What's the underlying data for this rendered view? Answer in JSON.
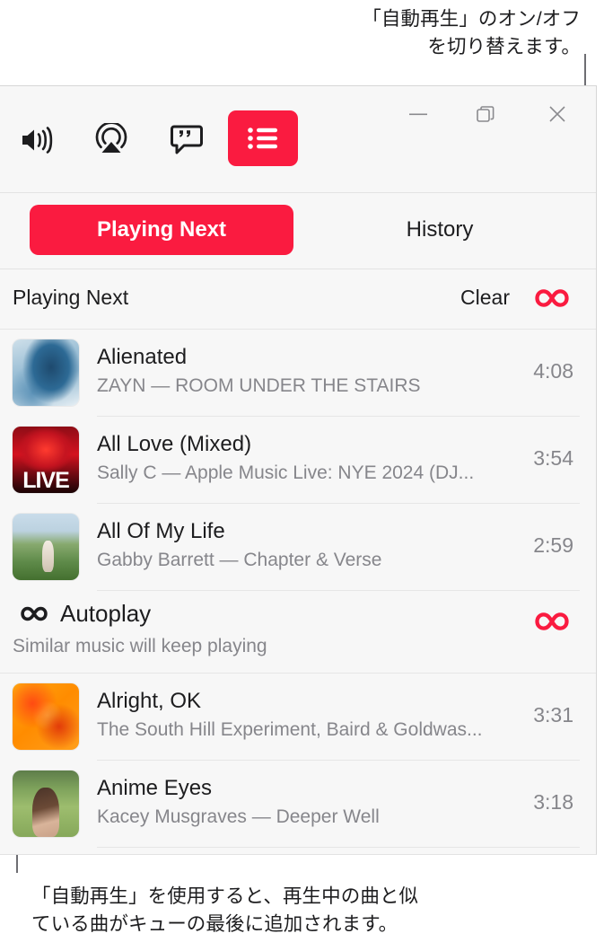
{
  "captions": {
    "top": "「自動再生」のオン/オフ\nを切り替えます。",
    "bottom": "「自動再生」を使用すると、再生中の曲と似\nている曲がキューの最後に追加されます。"
  },
  "colors": {
    "accent_red": "#fa1b40",
    "panel_bg": "#f7f7f7",
    "primary_text": "#1d1d1f",
    "secondary_text": "#86868b",
    "divider": "#e6e6e6",
    "callout_line": "#6e6e73"
  },
  "toolbar": {
    "icons": [
      {
        "name": "volume-icon",
        "label": "Volume"
      },
      {
        "name": "airplay-icon",
        "label": "AirPlay"
      },
      {
        "name": "lyrics-icon",
        "label": "Lyrics"
      },
      {
        "name": "queue-icon",
        "label": "Playing Next",
        "active": true
      }
    ],
    "window_controls": [
      {
        "name": "minimize-icon",
        "label": "Minimize"
      },
      {
        "name": "restore-icon",
        "label": "Restore"
      },
      {
        "name": "close-icon",
        "label": "Close"
      }
    ]
  },
  "tabs": [
    {
      "label": "Playing Next",
      "selected": true
    },
    {
      "label": "History",
      "selected": false
    }
  ],
  "queue_header": {
    "title": "Playing Next",
    "clear_label": "Clear",
    "infinity_icon": "infinity-icon"
  },
  "tracks": [
    {
      "title": "Alienated",
      "subtitle": "ZAYN — ROOM UNDER THE STAIRS",
      "duration": "4:08",
      "art": "art-alienated"
    },
    {
      "title": "All Love (Mixed)",
      "subtitle": "Sally C — Apple Music Live: NYE 2024 (DJ...",
      "duration": "3:54",
      "art": "art-alllove"
    },
    {
      "title": "All Of My Life",
      "subtitle": "Gabby Barrett — Chapter & Verse",
      "duration": "2:59",
      "art": "art-myLife"
    }
  ],
  "autoplay": {
    "title": "Autoplay",
    "subtitle": "Similar music will keep playing",
    "icon": "infinity-icon",
    "toggle_icon": "infinity-icon",
    "enabled": true
  },
  "autoplay_tracks": [
    {
      "title": "Alright, OK",
      "subtitle": "The South Hill Experiment, Baird & Goldwas...",
      "duration": "3:31",
      "art": "art-alright"
    },
    {
      "title": "Anime Eyes",
      "subtitle": "Kacey Musgraves — Deeper Well",
      "duration": "3:18",
      "art": "art-anime"
    }
  ]
}
